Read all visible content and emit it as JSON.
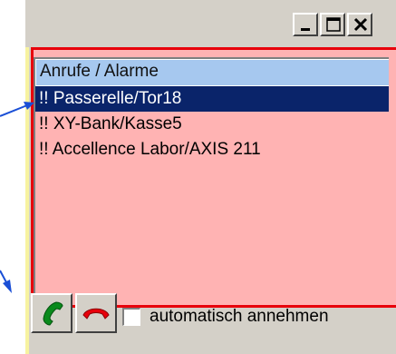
{
  "window": {
    "minimize_label": "_",
    "maximize_label": "□",
    "close_label": "✕"
  },
  "list": {
    "header": "Anrufe / Alarme",
    "items": [
      {
        "label": "!! Passerelle/Tor18",
        "selected": true
      },
      {
        "label": "!! XY-Bank/Kasse5",
        "selected": false
      },
      {
        "label": "!! Accellence Labor/AXIS 211",
        "selected": false
      }
    ]
  },
  "toolbar": {
    "accept_icon": "phone-accept-icon",
    "hangup_icon": "phone-hangup-icon",
    "auto_answer_label": "automatisch annehmen",
    "auto_answer_checked": false
  },
  "colors": {
    "frame_red": "#e8000b",
    "list_bg": "#ffb3b3",
    "header_bg": "#a6c8ef",
    "selection_bg": "#0a246a",
    "arrow_blue": "#1a4fd6"
  }
}
